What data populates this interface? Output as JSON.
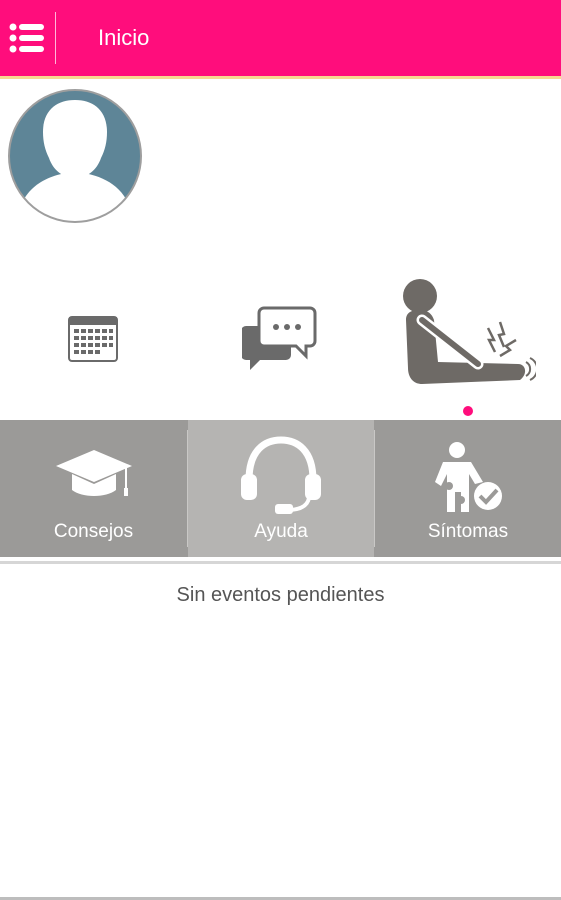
{
  "header": {
    "title": "Inicio",
    "accent_color": "#ff0d7c",
    "menu_icon": "list-menu-icon"
  },
  "profile": {
    "avatar_icon": "user-avatar-icon"
  },
  "quick_actions": [
    {
      "icon": "calendar-icon"
    },
    {
      "icon": "chat-bubbles-icon"
    },
    {
      "icon": "pain-person-icon"
    }
  ],
  "pager": {
    "current": 3,
    "total": 3
  },
  "tiles": [
    {
      "label": "Consejos",
      "icon": "graduation-cap-icon"
    },
    {
      "label": "Ayuda",
      "icon": "headset-icon",
      "active": true
    },
    {
      "label": "Síntomas",
      "icon": "body-check-icon"
    }
  ],
  "events": {
    "empty_message": "Sin eventos pendientes"
  }
}
